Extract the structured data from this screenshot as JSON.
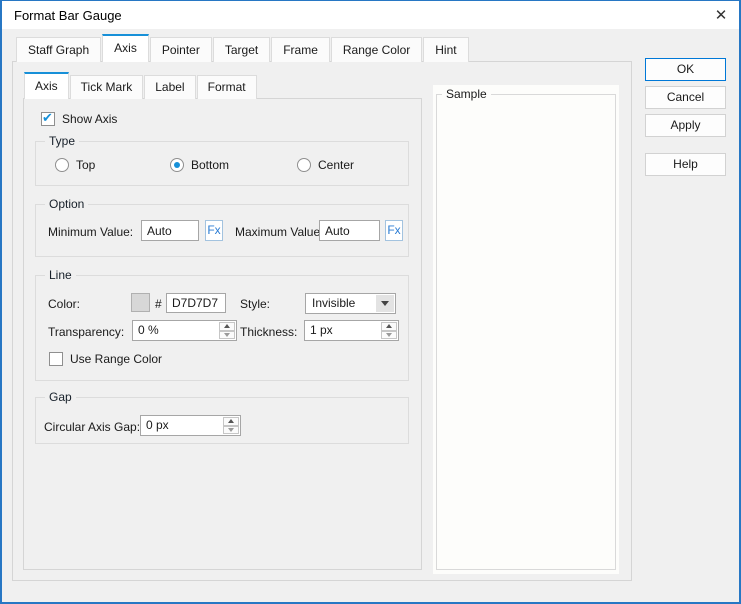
{
  "window": {
    "title": "Format Bar Gauge"
  },
  "icons": {
    "close": "✕",
    "check": "✔"
  },
  "tabs_primary": [
    {
      "label": "Staff Graph",
      "selected": false
    },
    {
      "label": "Axis",
      "selected": true
    },
    {
      "label": "Pointer",
      "selected": false
    },
    {
      "label": "Target",
      "selected": false
    },
    {
      "label": "Frame",
      "selected": false
    },
    {
      "label": "Range Color",
      "selected": false
    },
    {
      "label": "Hint",
      "selected": false
    }
  ],
  "tabs_secondary": [
    {
      "label": "Axis",
      "selected": true
    },
    {
      "label": "Tick Mark",
      "selected": false
    },
    {
      "label": "Label",
      "selected": false
    },
    {
      "label": "Format",
      "selected": false
    }
  ],
  "panel": {
    "show_axis": {
      "label": "Show Axis",
      "checked": true
    },
    "type_group": {
      "legend": "Type",
      "options": [
        {
          "label": "Top",
          "selected": false
        },
        {
          "label": "Bottom",
          "selected": true
        },
        {
          "label": "Center",
          "selected": false
        }
      ]
    },
    "option_group": {
      "legend": "Option",
      "minimum_label": "Minimum Value:",
      "minimum_value": "Auto",
      "maximum_label": "Maximum Value:",
      "maximum_value": "Auto",
      "fx_label": "Fx"
    },
    "line_group": {
      "legend": "Line",
      "color_label": "Color:",
      "hash_symbol": "#",
      "color_hex": "D7D7D7",
      "swatch_color": "#D7D7D7",
      "style_label": "Style:",
      "style_value": "Invisible",
      "transparency_label": "Transparency:",
      "transparency_value": "0 %",
      "thickness_label": "Thickness:",
      "thickness_value": "1 px",
      "use_range_color": {
        "label": "Use Range Color",
        "checked": false
      }
    },
    "gap_group": {
      "legend": "Gap",
      "gap_label": "Circular Axis Gap:",
      "gap_value": "0 px"
    }
  },
  "sample": {
    "legend": "Sample"
  },
  "action_buttons": {
    "ok": "OK",
    "cancel": "Cancel",
    "apply": "Apply",
    "help": "Help"
  },
  "colors": {
    "accent_blue": "#1790d8",
    "dialog_border": "#2777c4",
    "ok_border": "#0078d7",
    "fx_blue": "#2b7cd3",
    "swatch": "#D7D7D7"
  }
}
